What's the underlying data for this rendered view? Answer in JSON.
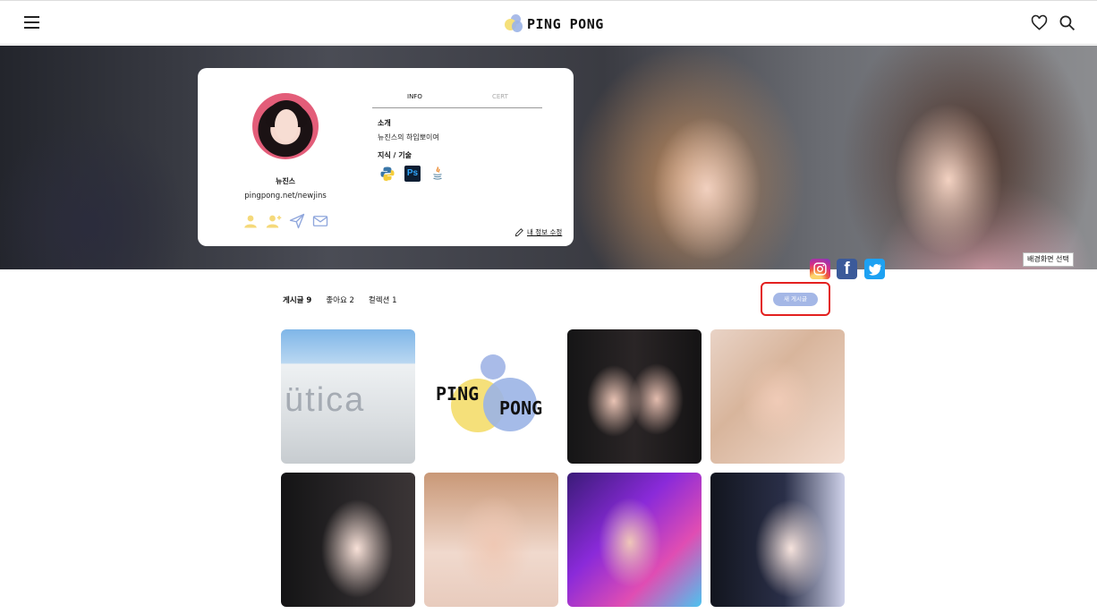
{
  "header": {
    "logo_text": "PING PONG",
    "menu_icon": "hamburger-icon",
    "heart_icon": "heart-icon",
    "search_icon": "search-icon"
  },
  "banner": {
    "select_background_label": "배경화면 선택"
  },
  "profile": {
    "name": "뉴진스",
    "url": "pingpong.net/newjins",
    "tabs": [
      "INFO",
      "CERT"
    ],
    "active_tab": "INFO",
    "intro_label": "소개",
    "intro_text": "뉴진스의 하입뽀이여",
    "skills_label": "지식 / 기술",
    "skills": [
      "python",
      "Ps",
      "Java"
    ],
    "edit_label": "내 정보 수정",
    "actions": [
      "person-icon",
      "person-add-icon",
      "send-icon",
      "mail-icon"
    ]
  },
  "social": [
    "instagram-icon",
    "facebook-icon",
    "twitter-icon"
  ],
  "stats": {
    "posts": "게시글 9",
    "likes": "좋아요 2",
    "collections": "컬렉션 1"
  },
  "new_post_label": "새 게시글",
  "posts": {
    "p1_text": "ütica",
    "p2_text1": "PING",
    "p2_text2": "PONG",
    "count_shown": 8
  },
  "colors": {
    "accent": "#a4b7e6",
    "logo_yellow": "#f5e07a",
    "logo_blue": "#a9bbe8",
    "highlight": "#e3201f"
  }
}
